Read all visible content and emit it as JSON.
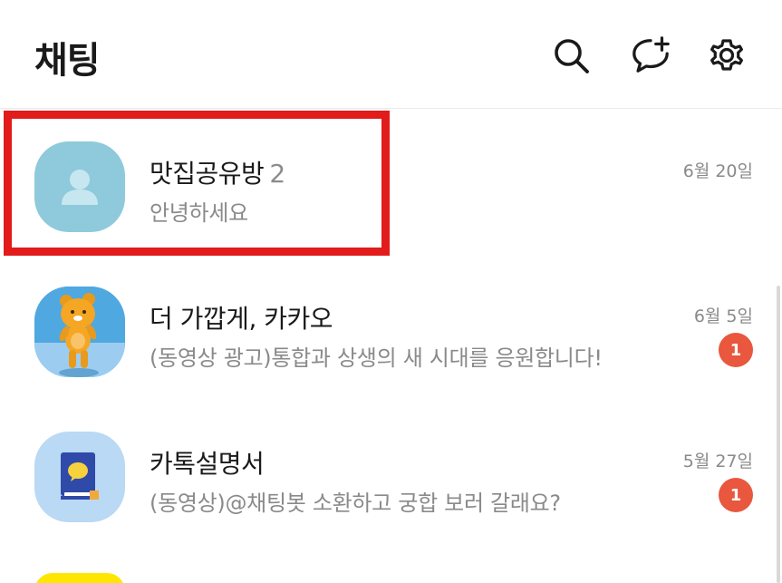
{
  "header": {
    "title": "채팅",
    "icons": [
      "search-icon",
      "new-chat-icon",
      "settings-icon"
    ]
  },
  "chats": [
    {
      "name": "맛집공유방",
      "member_count": "2",
      "preview": "안녕하세요",
      "date": "6월 20일",
      "unread": "",
      "avatar": "default-profile-icon"
    },
    {
      "name": "더 가깝게, 카카오",
      "member_count": "",
      "preview": "(동영상 광고)통합과 상생의 새 시대를 응원합니다!",
      "date": "6월 5일",
      "unread": "1",
      "avatar": "ryan-character-icon"
    },
    {
      "name": "카톡설명서",
      "member_count": "",
      "preview": "(동영상)@채팅봇 소환하고 궁합 보러 갈래요?",
      "date": "5월 27일",
      "unread": "1",
      "avatar": "guide-book-icon"
    }
  ],
  "colors": {
    "highlight": "#e21b1b",
    "badge": "#e8573e",
    "default_avatar": "#8ecadb"
  }
}
